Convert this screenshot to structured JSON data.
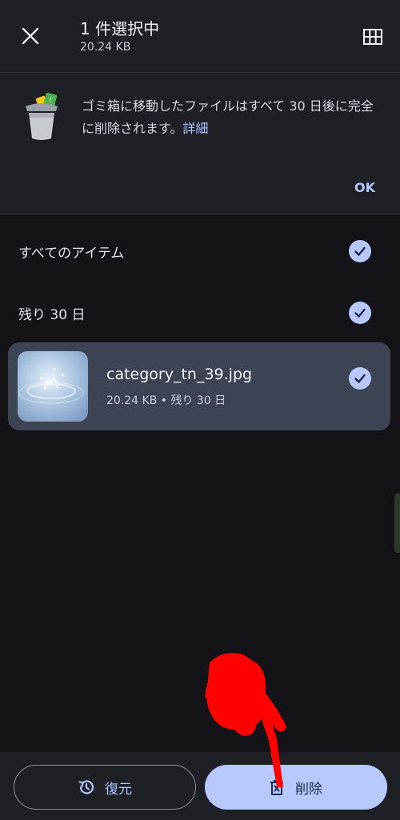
{
  "header": {
    "title": "1 件選択中",
    "subtitle": "20.24 KB"
  },
  "banner": {
    "message": "ゴミ箱に移動したファイルはすべて 30 日後に完全に削除されます。",
    "details_link": "詳細",
    "ok_label": "OK"
  },
  "sections": {
    "all_items_label": "すべてのアイテム",
    "days_left_label": "残り 30 日"
  },
  "file": {
    "name": "category_tn_39.jpg",
    "meta": "20.24 KB • 残り 30 日"
  },
  "actions": {
    "restore_label": "復元",
    "delete_label": "削除"
  },
  "colors": {
    "accent": "#b7c9ff",
    "link": "#aec5ff",
    "annotation": "#ff0000"
  }
}
